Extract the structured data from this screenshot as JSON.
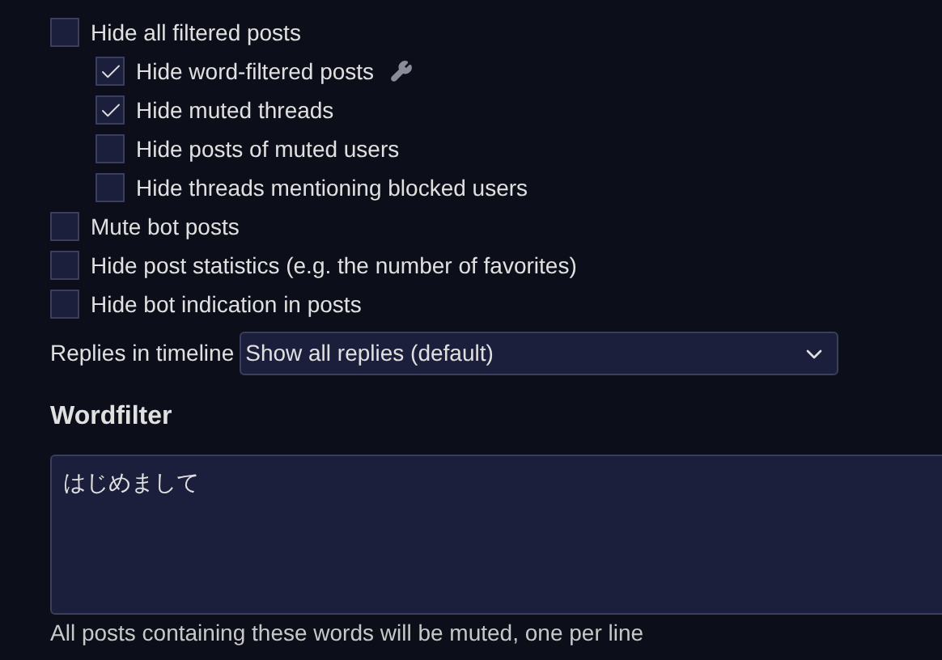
{
  "options": [
    {
      "label": "Hide all filtered posts",
      "checked": false,
      "children": [
        {
          "label": "Hide word-filtered posts",
          "checked": true,
          "settings": true
        },
        {
          "label": "Hide muted threads",
          "checked": true
        },
        {
          "label": "Hide posts of muted users",
          "checked": false
        },
        {
          "label": "Hide threads mentioning blocked users",
          "checked": false
        }
      ]
    },
    {
      "label": "Mute bot posts",
      "checked": false
    },
    {
      "label": "Hide post statistics (e.g. the number of favorites)",
      "checked": false
    },
    {
      "label": "Hide bot indication in posts",
      "checked": false
    }
  ],
  "replies": {
    "label": "Replies in timeline",
    "value": "Show all replies (default)"
  },
  "wordfilter": {
    "title": "Wordfilter",
    "value": "はじめまして",
    "hint": "All posts containing these words will be muted, one per line"
  }
}
